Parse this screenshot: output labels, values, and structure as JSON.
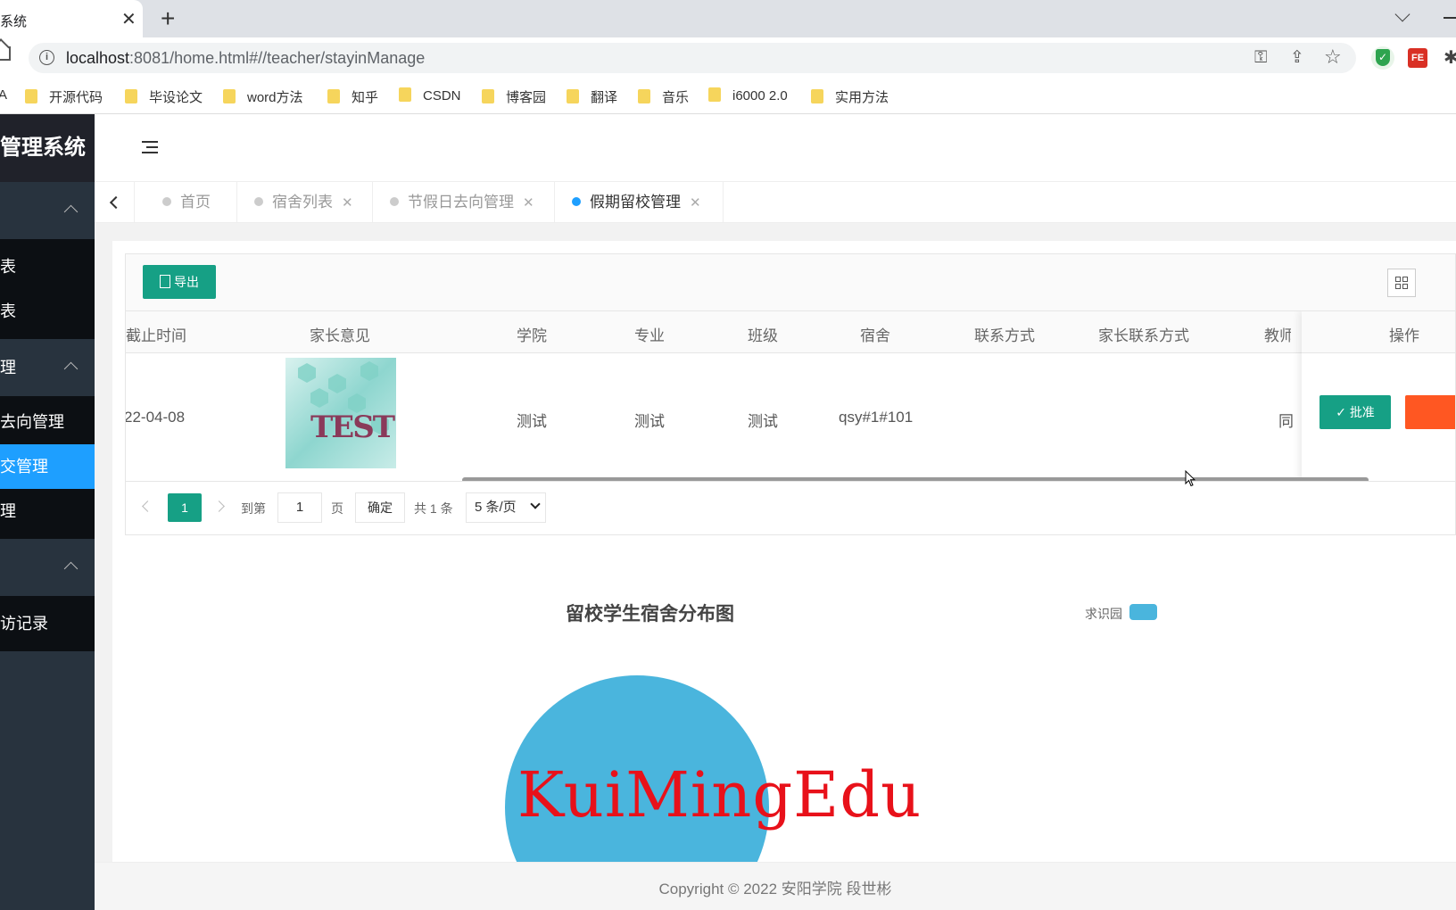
{
  "browser": {
    "tab_title": "系统",
    "close_symbol": "✕",
    "new_tab_symbol": "+",
    "url_host": "localhost",
    "url_rest": ":8081/home.html#//teacher/stayinManage",
    "info_symbol": "i",
    "bookmarks": [
      "开源代码",
      "毕设论文",
      "word方法",
      "知乎",
      "CSDN",
      "博客园",
      "翻译",
      "音乐",
      "i6000 2.0",
      "实用方法"
    ],
    "bookmark_prefix": "A"
  },
  "sidebar": {
    "logo": "管理系统",
    "items": [
      "表",
      "表",
      "理",
      "去向管理",
      "交管理",
      "理",
      "访记录"
    ]
  },
  "tabs": [
    {
      "label": "首页"
    },
    {
      "label": "宿舍列表"
    },
    {
      "label": "节假日去向管理"
    },
    {
      "label": "假期留校管理"
    }
  ],
  "toolbar": {
    "export_label": "导出"
  },
  "table": {
    "headers": [
      "截止时间",
      "家长意见",
      "学院",
      "专业",
      "班级",
      "宿舍",
      "联系方式",
      "家长联系方式",
      "教师",
      "操作"
    ],
    "row": {
      "deadline": "22-04-08",
      "college": "测试",
      "major": "测试",
      "class": "测试",
      "dorm": "qsy#1#101",
      "teacher": "同",
      "thumb_text": "TEST"
    },
    "approve_label": "批准"
  },
  "pager": {
    "current": "1",
    "goto_label": "到第",
    "page_input": "1",
    "page_unit": "页",
    "confirm_label": "确定",
    "total_label": "共 1 条",
    "page_size": "5 条/页"
  },
  "chart_data": {
    "type": "pie",
    "title": "留校学生宿舍分布图",
    "legend": [
      "求识园"
    ],
    "slices": [
      {
        "name": "求识园",
        "value": 1
      }
    ],
    "colors": [
      "#4ab5dd"
    ]
  },
  "watermark": "KuiMingEdu",
  "footer": "Copyright © 2022 安阳学院 段世彬"
}
